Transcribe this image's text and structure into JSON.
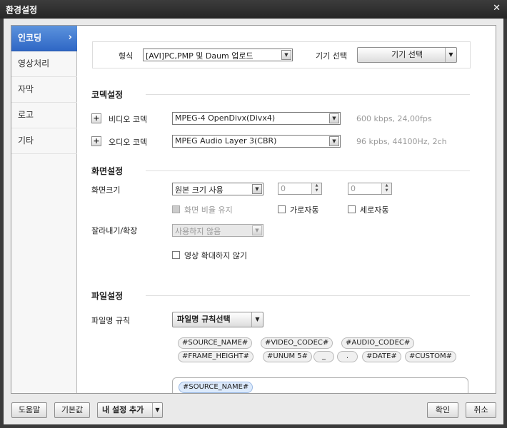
{
  "window": {
    "title": "환경설정"
  },
  "sidebar": {
    "items": [
      {
        "label": "인코딩",
        "active": true
      },
      {
        "label": "영상처리"
      },
      {
        "label": "자막"
      },
      {
        "label": "로고"
      },
      {
        "label": "기타"
      }
    ],
    "chevron": "›"
  },
  "format": {
    "label": "형식",
    "value": "[AVI]PC,PMP 및 Daum 업로드",
    "device_label": "기기 선택",
    "device_button": "기기 선택"
  },
  "codec": {
    "section_title": "코덱설정",
    "video_label": "비디오 코덱",
    "video_value": "MPEG-4 OpenDivx(Divx4)",
    "video_info": "600 kbps, 24,00fps",
    "audio_label": "오디오 코덱",
    "audio_value": "MPEG Audio Layer 3(CBR)",
    "audio_info": "96 kpbs, 44100Hz, 2ch"
  },
  "screen": {
    "section_title": "화면설정",
    "size_label": "화면크기",
    "size_value": "원본 크기 사용",
    "width_value": "0",
    "height_value": "0",
    "keep_ratio_label": "화면 비율 유지",
    "auto_width_label": "가로자동",
    "auto_height_label": "세로자동",
    "crop_label": "잘라내기/확장",
    "crop_value": "사용하지 않음",
    "no_enlarge_label": "영상 확대하지 않기"
  },
  "file": {
    "section_title": "파일설정",
    "naming_label": "파일명 규칙",
    "naming_button": "파일명 규칙선택",
    "tags": [
      "#SOURCE_NAME#",
      "#VIDEO_CODEC#",
      "#AUDIO_CODEC#",
      "#FRAME_HEIGHT#",
      "#UNUM 5#",
      "_",
      ".",
      "#DATE#",
      "#CUSTOM#"
    ],
    "current_rule_tag": "#SOURCE_NAME#"
  },
  "footer": {
    "help": "도움말",
    "default": "기본값",
    "add_my_setting": "내 설정 추가",
    "ok": "확인",
    "cancel": "취소"
  },
  "icons": {
    "close": "close-icon",
    "plus": "plus-icon",
    "dropdown": "chevron-down-icon"
  }
}
